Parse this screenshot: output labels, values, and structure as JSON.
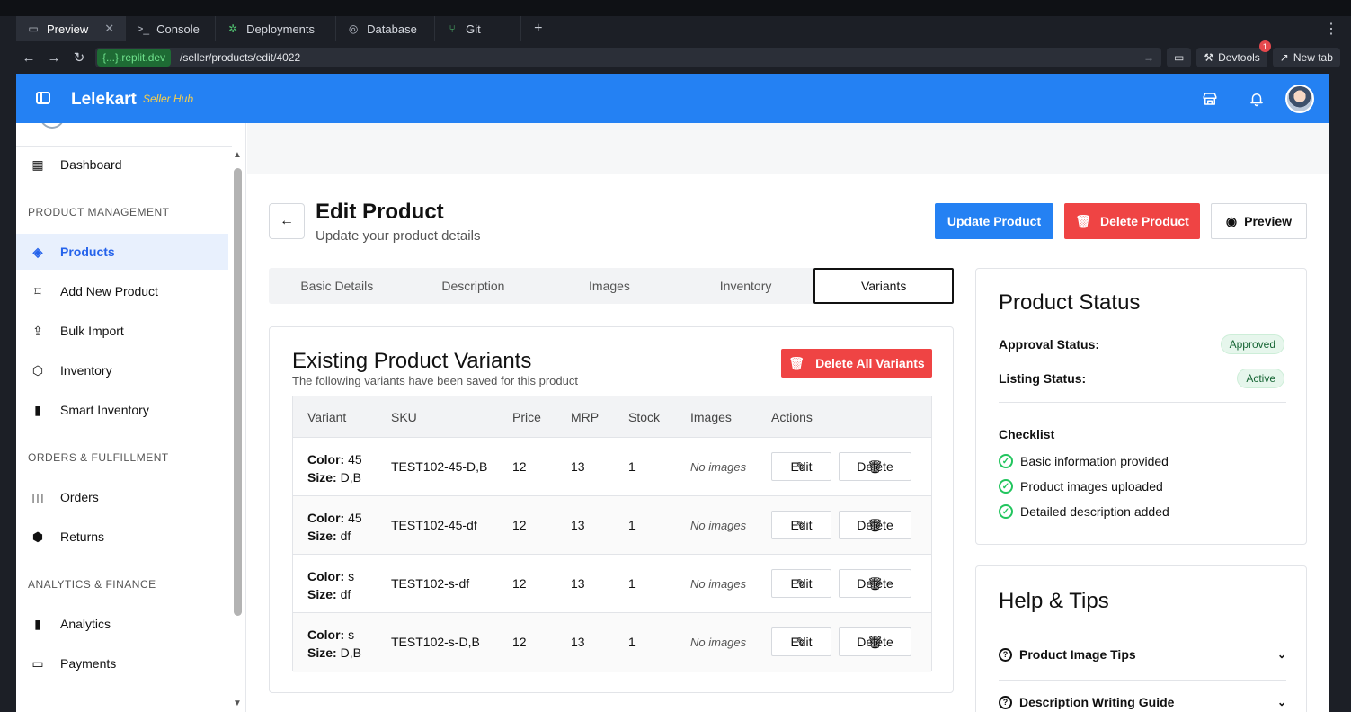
{
  "ide": {
    "tabs": [
      {
        "label": "Preview",
        "icon": "monitor-icon"
      },
      {
        "label": "Console",
        "icon": "terminal-icon"
      },
      {
        "label": "Deployments",
        "icon": "deploy-icon"
      },
      {
        "label": "Database",
        "icon": "database-icon"
      },
      {
        "label": "Git",
        "icon": "git-icon"
      }
    ],
    "url_domain": "{...}.replit.dev",
    "url_path": "/seller/products/edit/4022",
    "devtools_label": "Devtools",
    "devtools_badge": "1",
    "new_tab_label": "New tab"
  },
  "header": {
    "brand": "Lelekart",
    "brand_sub": "Seller Hub"
  },
  "sidebar": {
    "dashboard": "Dashboard",
    "section_product": "PRODUCT MANAGEMENT",
    "products": "Products",
    "add_new_product": "Add New Product",
    "bulk_import": "Bulk Import",
    "inventory": "Inventory",
    "smart_inventory": "Smart Inventory",
    "section_orders": "ORDERS & FULFILLMENT",
    "orders": "Orders",
    "returns": "Returns",
    "section_analytics": "ANALYTICS & FINANCE",
    "analytics": "Analytics",
    "payments": "Payments"
  },
  "page": {
    "title": "Edit Product",
    "subtitle": "Update your product details",
    "update_label": "Update Product",
    "delete_label": "Delete Product",
    "preview_label": "Preview"
  },
  "tabs": [
    "Basic Details",
    "Description",
    "Images",
    "Inventory",
    "Variants"
  ],
  "active_tab": "Variants",
  "variants": {
    "title": "Existing Product Variants",
    "subtitle": "The following variants have been saved for this product",
    "delete_all_label": "Delete All Variants",
    "columns": [
      "Variant",
      "SKU",
      "Price",
      "MRP",
      "Stock",
      "Images",
      "Actions"
    ],
    "color_label": "Color:",
    "size_label": "Size:",
    "edit_label": "Edit",
    "delete_label": "Delete",
    "no_images": "No images",
    "rows": [
      {
        "color": "45",
        "size": "D,B",
        "sku": "TEST102-45-D,B",
        "price": "12",
        "mrp": "13",
        "stock": "1"
      },
      {
        "color": "45",
        "size": "df",
        "sku": "TEST102-45-df",
        "price": "12",
        "mrp": "13",
        "stock": "1"
      },
      {
        "color": "s",
        "size": "df",
        "sku": "TEST102-s-df",
        "price": "12",
        "mrp": "13",
        "stock": "1"
      },
      {
        "color": "s",
        "size": "D,B",
        "sku": "TEST102-s-D,B",
        "price": "12",
        "mrp": "13",
        "stock": "1"
      }
    ]
  },
  "status": {
    "title": "Product Status",
    "approval_label": "Approval Status:",
    "approval_value": "Approved",
    "listing_label": "Listing Status:",
    "listing_value": "Active",
    "checklist_title": "Checklist",
    "checklist": [
      "Basic information provided",
      "Product images uploaded",
      "Detailed description added"
    ]
  },
  "help": {
    "title": "Help & Tips",
    "items": [
      "Product Image Tips",
      "Description Writing Guide"
    ]
  },
  "colors": {
    "brand_blue": "#2481f3",
    "danger_red": "#ef4444",
    "brand_sub_yellow": "#f9cf4a",
    "success_green": "#22c55e"
  }
}
